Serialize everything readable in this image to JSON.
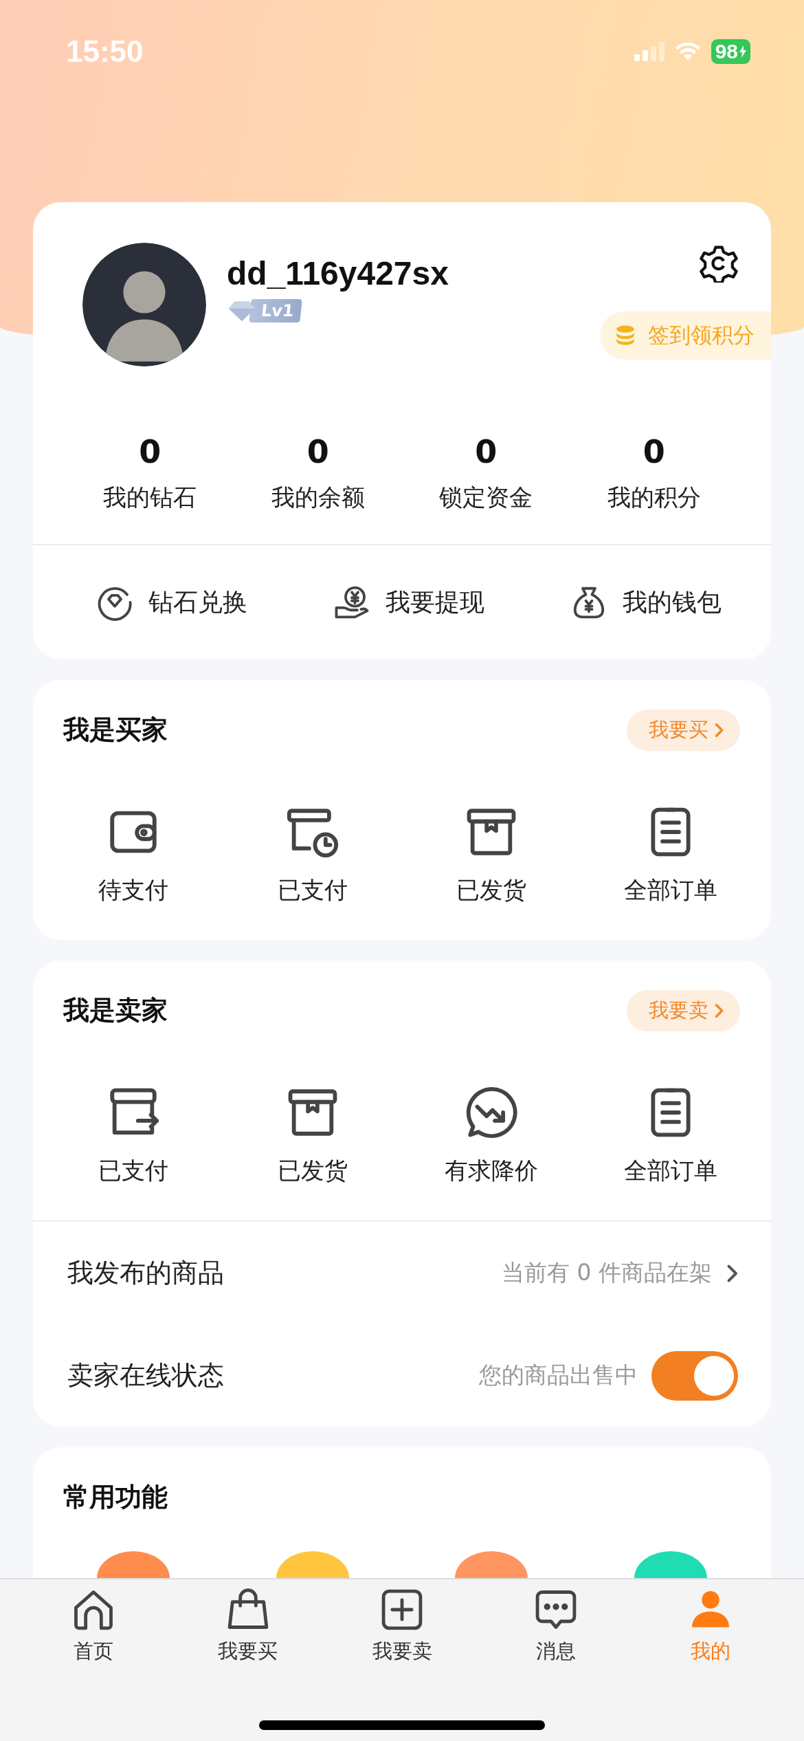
{
  "status_bar": {
    "time": "15:50",
    "battery": "98"
  },
  "profile": {
    "username": "dd_116y427sx",
    "level": "Lv1",
    "checkin_button": "签到领积分"
  },
  "stats": [
    {
      "value": "0",
      "label": "我的钻石"
    },
    {
      "value": "0",
      "label": "我的余额"
    },
    {
      "value": "0",
      "label": "锁定资金"
    },
    {
      "value": "0",
      "label": "我的积分"
    }
  ],
  "actions": [
    {
      "kind": "diamond",
      "label": "钻石兑换"
    },
    {
      "kind": "withdraw",
      "label": "我要提现"
    },
    {
      "kind": "moneybag",
      "label": "我的钱包"
    }
  ],
  "buyer": {
    "title": "我是买家",
    "link": "我要买",
    "items": [
      {
        "kind": "wallet",
        "label": "待支付"
      },
      {
        "kind": "clockbox",
        "label": "已支付"
      },
      {
        "kind": "box",
        "label": "已发货"
      },
      {
        "kind": "clipboard",
        "label": "全部订单"
      }
    ]
  },
  "seller": {
    "title": "我是卖家",
    "link": "我要卖",
    "items": [
      {
        "kind": "boxout",
        "label": "已支付"
      },
      {
        "kind": "box",
        "label": "已发货"
      },
      {
        "kind": "pricedown",
        "label": "有求降价"
      },
      {
        "kind": "clipboard",
        "label": "全部订单"
      }
    ],
    "rows": [
      {
        "kind": "link",
        "label": "我发布的商品",
        "value": "当前有 0 件商品在架"
      },
      {
        "kind": "toggle",
        "label": "卖家在线状态",
        "value": "您的商品出售中",
        "on": true
      }
    ]
  },
  "common": {
    "title": "常用功能",
    "items": [
      {
        "color": "#ff8d4e"
      },
      {
        "color": "#ffc53f"
      },
      {
        "color": "#ff9560"
      },
      {
        "color": "#1fdcb2"
      }
    ]
  },
  "tab_bar": [
    {
      "kind": "home",
      "label": "首页",
      "selected": false
    },
    {
      "kind": "bag",
      "label": "我要买",
      "selected": false
    },
    {
      "kind": "plus",
      "label": "我要卖",
      "selected": false
    },
    {
      "kind": "chat",
      "label": "消息",
      "selected": false
    },
    {
      "kind": "person",
      "label": "我的",
      "selected": true
    }
  ]
}
